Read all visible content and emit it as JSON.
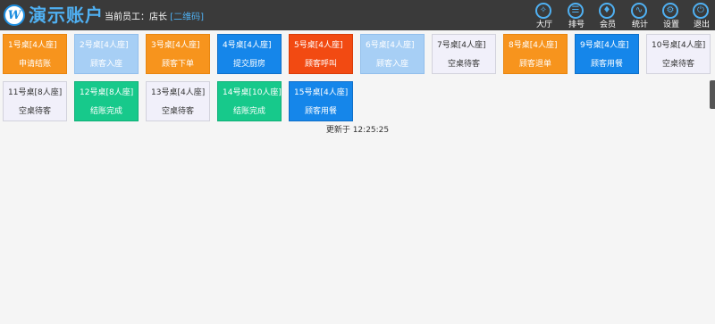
{
  "header": {
    "logo_letter": "W",
    "title": "演示账户",
    "staff_label": "当前员工：店长",
    "qr_link": "[二维码]"
  },
  "nav": [
    {
      "label": "大厅",
      "icon": "compass-icon",
      "glyph": "✧"
    },
    {
      "label": "排号",
      "icon": "queue-icon",
      "glyph": "☰"
    },
    {
      "label": "会员",
      "icon": "member-icon",
      "glyph": "♦"
    },
    {
      "label": "统计",
      "icon": "chart-icon",
      "glyph": "∿"
    },
    {
      "label": "设置",
      "icon": "gear-icon",
      "glyph": "⚙"
    },
    {
      "label": "退出",
      "icon": "exit-icon",
      "glyph": "⏻"
    }
  ],
  "tables": [
    {
      "name": "1号桌[4人座]",
      "status": "申请结账",
      "color": "#f7941d"
    },
    {
      "name": "2号桌[4人座]",
      "status": "顾客入座",
      "color": "#a7cff5"
    },
    {
      "name": "3号桌[4人座]",
      "status": "顾客下单",
      "color": "#f7941d"
    },
    {
      "name": "4号桌[4人座]",
      "status": "提交厨房",
      "color": "#1586ea"
    },
    {
      "name": "5号桌[4人座]",
      "status": "顾客呼叫",
      "color": "#f24a12"
    },
    {
      "name": "6号桌[4人座]",
      "status": "顾客入座",
      "color": "#a7cff5"
    },
    {
      "name": "7号桌[4人座]",
      "status": "空桌待客",
      "color": "#f1f0fa"
    },
    {
      "name": "8号桌[4人座]",
      "status": "顾客退单",
      "color": "#f7941d"
    },
    {
      "name": "9号桌[4人座]",
      "status": "顾客用餐",
      "color": "#1586ea"
    },
    {
      "name": "10号桌[4人座]",
      "status": "空桌待客",
      "color": "#f1f0fa"
    },
    {
      "name": "11号桌[8人座]",
      "status": "空桌待客",
      "color": "#f1f0fa"
    },
    {
      "name": "12号桌[8人座]",
      "status": "结账完成",
      "color": "#17c98b"
    },
    {
      "name": "13号桌[4人座]",
      "status": "空桌待客",
      "color": "#f1f0fa"
    },
    {
      "name": "14号桌[10人座]",
      "status": "结账完成",
      "color": "#17c98b"
    },
    {
      "name": "15号桌[4人座]",
      "status": "顾客用餐",
      "color": "#1586ea"
    }
  ],
  "updated_text": "更新于 12:25:25"
}
